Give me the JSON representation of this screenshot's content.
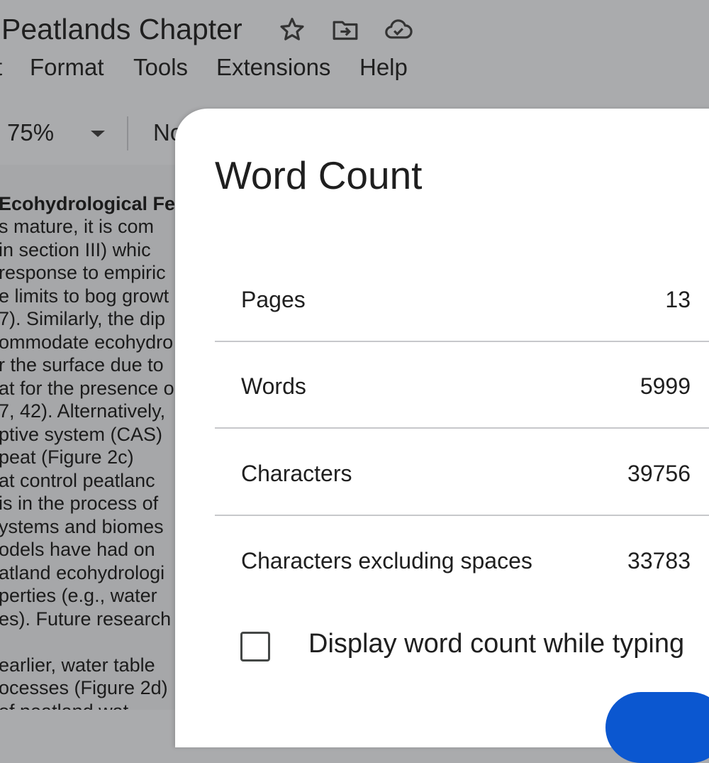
{
  "header": {
    "doc_title": "Peatlands Chapter",
    "icons": [
      "star-icon",
      "move-to-folder-icon",
      "cloud-saved-icon"
    ]
  },
  "menu": {
    "items": [
      {
        "label": "t"
      },
      {
        "label": "Format"
      },
      {
        "label": "Tools"
      },
      {
        "label": "Extensions"
      },
      {
        "label": "Help"
      }
    ]
  },
  "toolbar": {
    "zoom": "75%",
    "style": "No"
  },
  "document": {
    "heading": "Ecohydrological Fe",
    "lines": [
      "s mature, it is com",
      "in section III) whic",
      "response to empiric",
      "e limits to bog growt",
      "7). Similarly, the dip",
      "ommodate ecohydro",
      "r the surface due to",
      "at for the presence o",
      "7, 42). Alternatively,",
      "ptive system (CAS)",
      " peat (Figure 2c)",
      "at control peatlanc",
      "is in the process of",
      "ystems and biomes",
      "odels have had on",
      "atland ecohydrologi",
      "perties (e.g., water",
      "es). Future research",
      "",
      " earlier, water table",
      "ocesses (Figure 2d)",
      " of peatland wat"
    ]
  },
  "dialog": {
    "title": "Word Count",
    "stats": [
      {
        "label": "Pages",
        "value": "13"
      },
      {
        "label": "Words",
        "value": "5999"
      },
      {
        "label": "Characters",
        "value": "39756"
      },
      {
        "label": "Characters excluding spaces",
        "value": "33783"
      }
    ],
    "checkbox_label": "Display word count while typing",
    "checkbox_checked": false,
    "accent_color": "#0b57d0"
  }
}
